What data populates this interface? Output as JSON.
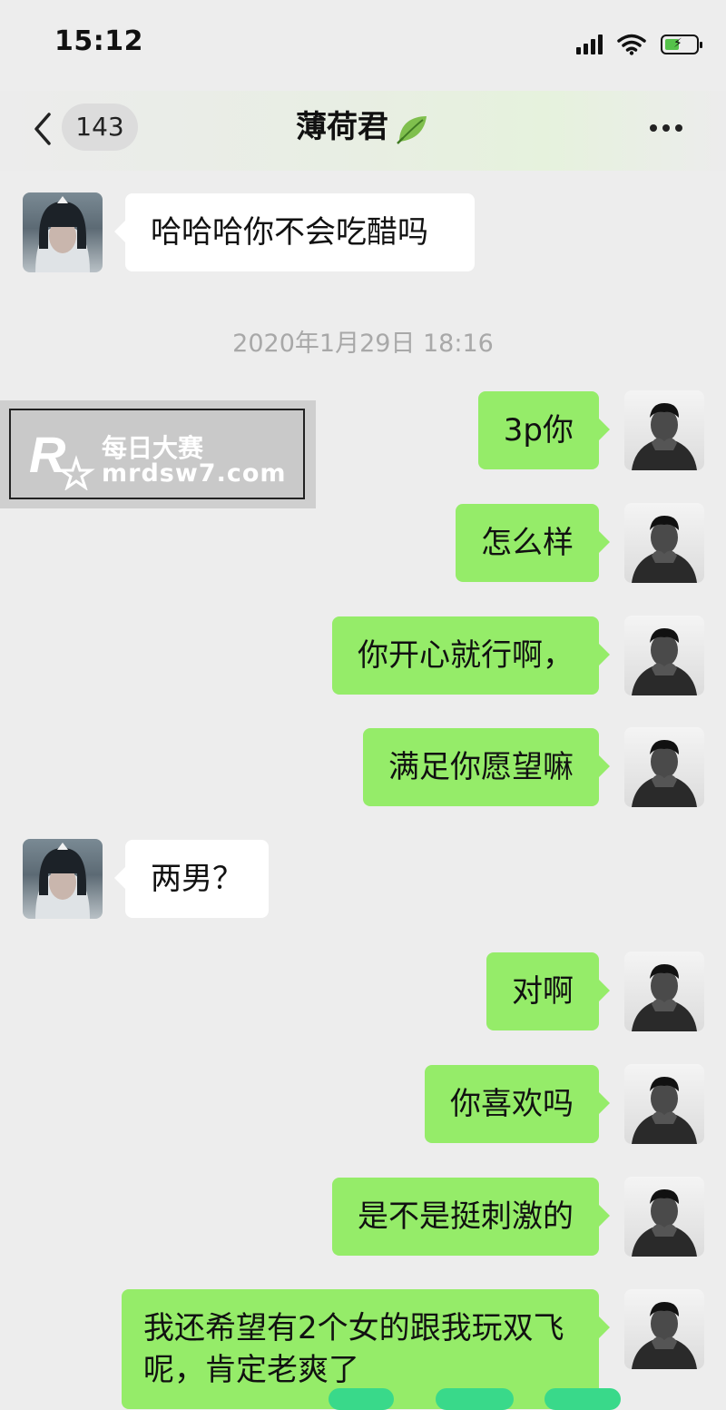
{
  "status_bar": {
    "time": "15:12",
    "icons": [
      "signal-icon",
      "wifi-icon",
      "battery-charging-icon"
    ]
  },
  "nav": {
    "back_count": "143",
    "title": "薄荷君",
    "title_icon": "leaf-icon",
    "more_icon": "more-icon"
  },
  "colors": {
    "background": "#ededed",
    "bubble_self": "#95ec69",
    "bubble_other": "#ffffff",
    "timestamp": "#a8a8a8"
  },
  "messages": [
    {
      "sender": "other",
      "text": "哈哈哈你不会吃醋吗"
    },
    {
      "sender": "self",
      "text": "3p你"
    },
    {
      "sender": "self",
      "text": "怎么样"
    },
    {
      "sender": "self",
      "text": "你开心就行啊，"
    },
    {
      "sender": "self",
      "text": "满足你愿望嘛"
    },
    {
      "sender": "other",
      "text": "两男？"
    },
    {
      "sender": "self",
      "text": "对啊"
    },
    {
      "sender": "self",
      "text": "你喜欢吗"
    },
    {
      "sender": "self",
      "text": "是不是挺刺激的"
    },
    {
      "sender": "self",
      "text": "我还希望有2个女的跟我玩双飞呢，肯定老爽了"
    }
  ],
  "timestamp": "2020年1月29日 18:16",
  "watermark": {
    "line1": "每日大赛",
    "line2": "mrdsw7.com"
  }
}
